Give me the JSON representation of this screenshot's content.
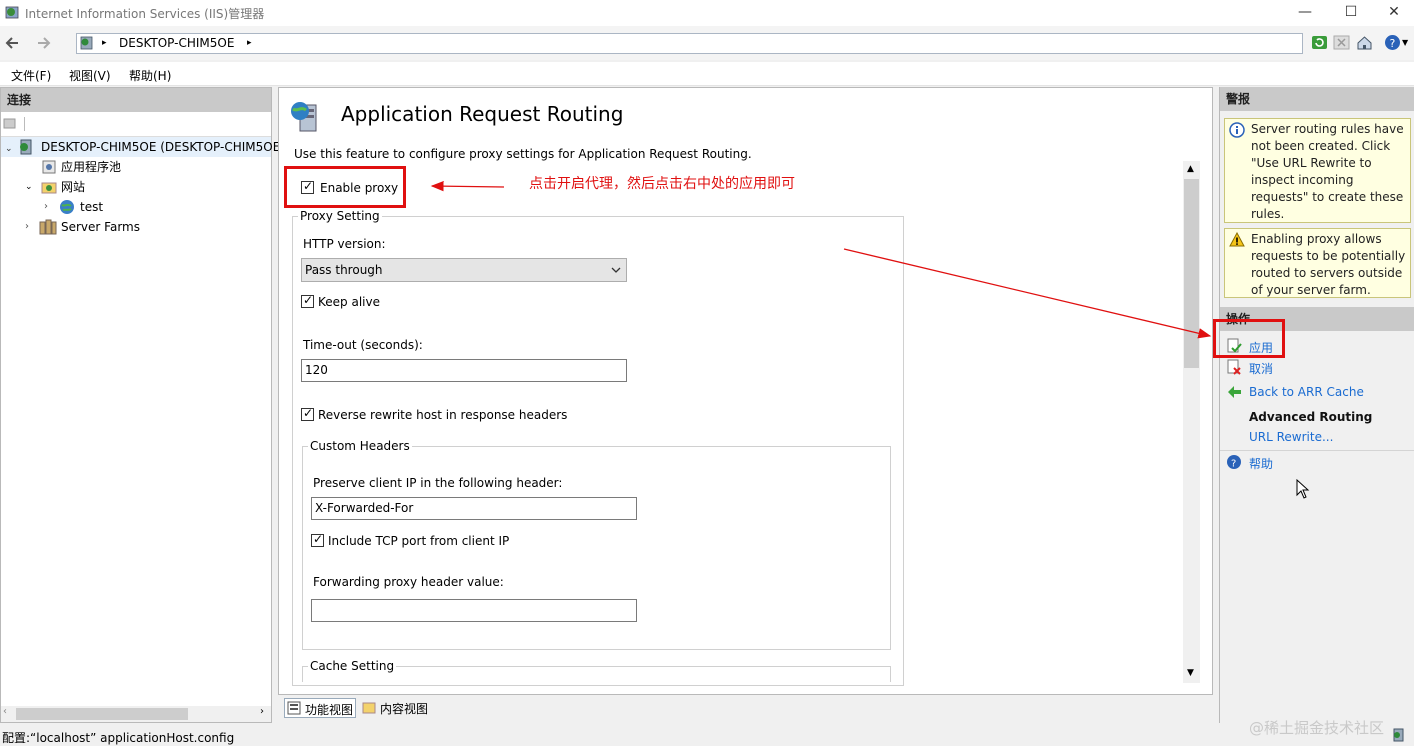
{
  "window": {
    "title": "Internet Information Services (IIS)管理器",
    "minimize_glyph": "—",
    "maximize_glyph": "☐",
    "close_glyph": "✕"
  },
  "address": {
    "path": "DESKTOP-CHIM5OE",
    "sep_glyph": "▸"
  },
  "menu": {
    "file": "文件(F)",
    "view": "视图(V)",
    "help": "帮助(H)"
  },
  "connections": {
    "header": "连接",
    "items": [
      {
        "label": "DESKTOP-CHIM5OE (DESKTOP-CHIM5OE\\",
        "icon": "server-icon"
      },
      {
        "label": "应用程序池",
        "icon": "app-pool-icon"
      },
      {
        "label": "网站",
        "icon": "sites-folder-icon"
      },
      {
        "label": "test",
        "icon": "globe-icon"
      },
      {
        "label": "Server Farms",
        "icon": "server-farms-icon"
      }
    ]
  },
  "main": {
    "title": "Application Request Routing",
    "description": "Use this feature to configure proxy settings for Application Request Routing.",
    "enable_proxy": {
      "label": "Enable proxy",
      "checked": true
    },
    "proxy_setting": {
      "legend": "Proxy Setting",
      "http_version_label": "HTTP version:",
      "http_version_value": "Pass through",
      "keep_alive": {
        "label": "Keep alive",
        "checked": true
      },
      "timeout_label": "Time-out (seconds):",
      "timeout_value": "120",
      "reverse_rewrite": {
        "label": "Reverse rewrite host in response headers",
        "checked": true
      }
    },
    "custom_headers": {
      "legend": "Custom Headers",
      "preserve_ip_label": "Preserve client IP in the following header:",
      "preserve_ip_value": "X-Forwarded-For",
      "include_tcp_port": {
        "label": "Include TCP port from client IP",
        "checked": true
      },
      "forwarding_label": "Forwarding proxy header value:",
      "forwarding_value": ""
    },
    "cache_setting": {
      "legend": "Cache Setting"
    },
    "tabs": {
      "features_view": "功能视图",
      "content_view": "内容视图"
    }
  },
  "alerts": {
    "header": "警报",
    "items": [
      {
        "icon": "info-icon",
        "text": "Server routing rules have not been created. Click \"Use URL Rewrite to inspect incoming requests\" to create these rules."
      },
      {
        "icon": "warning-icon",
        "text": "Enabling proxy allows requests to be potentially routed to servers outside of your server farm."
      }
    ]
  },
  "actions": {
    "header": "操作",
    "apply": "应用",
    "cancel": "取消",
    "back_to_cache": "Back to ARR Cache",
    "advanced_routing": "Advanced Routing",
    "url_rewrite": "URL Rewrite...",
    "help": "帮助"
  },
  "annotation": {
    "text": "点击开启代理，然后点击右中处的应用即可"
  },
  "status": {
    "text": "配置:“localhost” applicationHost.config",
    "watermark": "@稀土掘金技术社区"
  },
  "colors": {
    "annotation_red": "#e01010",
    "link_blue": "#1a6bd1",
    "alert_bg": "#ffffe1",
    "panel_header": "#c9c9c9"
  }
}
